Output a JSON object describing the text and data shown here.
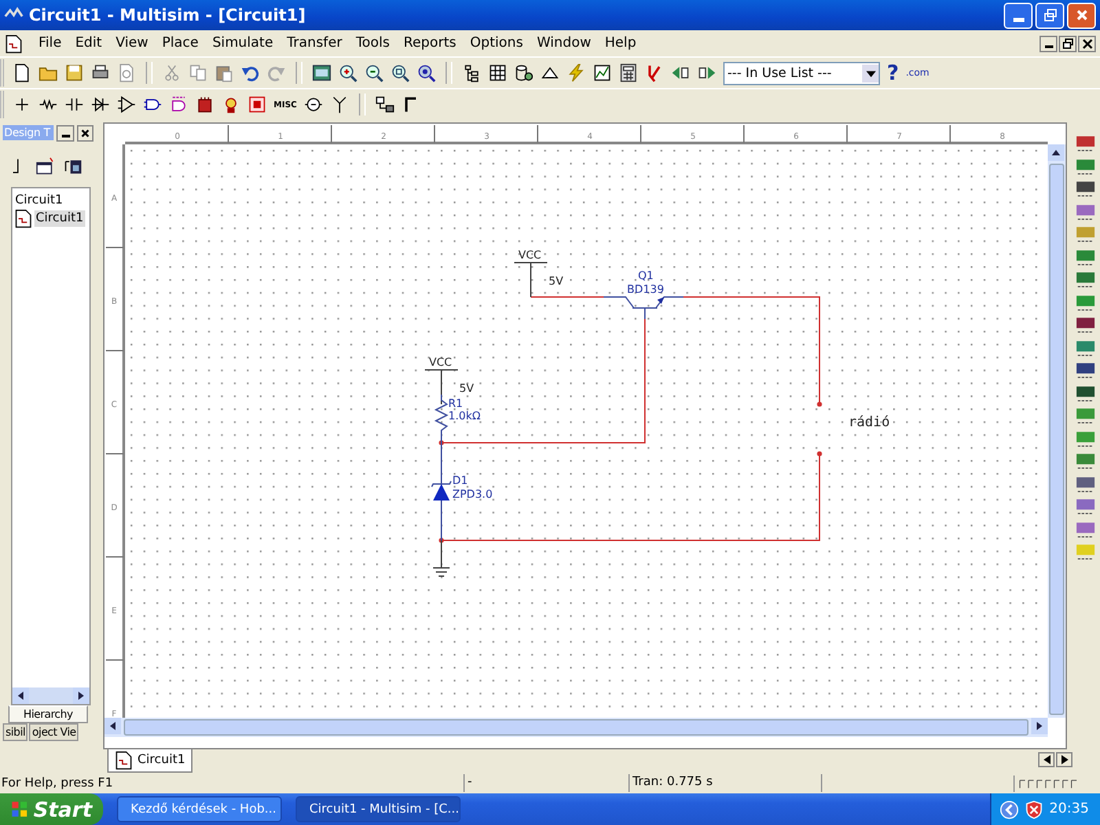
{
  "window": {
    "title": "Circuit1 - Multisim - [Circuit1]"
  },
  "menu": [
    "File",
    "Edit",
    "View",
    "Place",
    "Simulate",
    "Transfer",
    "Tools",
    "Reports",
    "Options",
    "Window",
    "Help"
  ],
  "toolbar": {
    "in_use_list": "--- In Use List ---",
    "help_label": "?",
    "web_label": ".com",
    "misc_label": "MISC"
  },
  "design_toolbox": {
    "title": "Design T",
    "tree": [
      {
        "label": "Circuit1",
        "selected": false,
        "children": [
          {
            "label": "Circuit1",
            "selected": true
          }
        ]
      }
    ],
    "tabs": [
      {
        "label": "Hierarchy",
        "selected": true
      },
      {
        "label": "sibil",
        "selected": false
      },
      {
        "label": "oject Vie",
        "selected": false
      }
    ]
  },
  "rulers": {
    "columns": [
      "0",
      "1",
      "2",
      "3",
      "4",
      "5",
      "6",
      "7",
      "8"
    ],
    "rows": [
      "A",
      "B",
      "C",
      "D",
      "E",
      "F"
    ]
  },
  "schematic": {
    "components": [
      {
        "kind": "vcc",
        "ref": "VCC",
        "value": "5V"
      },
      {
        "kind": "transistor",
        "ref": "Q1",
        "value": "BD139"
      },
      {
        "kind": "vcc",
        "ref": "VCC",
        "value": "5V"
      },
      {
        "kind": "resistor",
        "ref": "R1",
        "value": "1.0kΩ"
      },
      {
        "kind": "zener",
        "ref": "D1",
        "value": "ZPD3.0"
      },
      {
        "kind": "ground"
      }
    ],
    "note": "rádió"
  },
  "document_tabs": [
    {
      "label": "Circuit1",
      "selected": true
    }
  ],
  "status_bar": {
    "help": "For Help, press F1",
    "field_2": "-",
    "simulation": "Tran: 0.775 s"
  },
  "taskbar": {
    "start": "Start",
    "tasks": [
      {
        "label": "Kezdő kérdések - Hob...",
        "selected": false
      },
      {
        "label": "Circuit1 - Multisim - [C...",
        "selected": true
      }
    ],
    "clock": "20:35"
  }
}
